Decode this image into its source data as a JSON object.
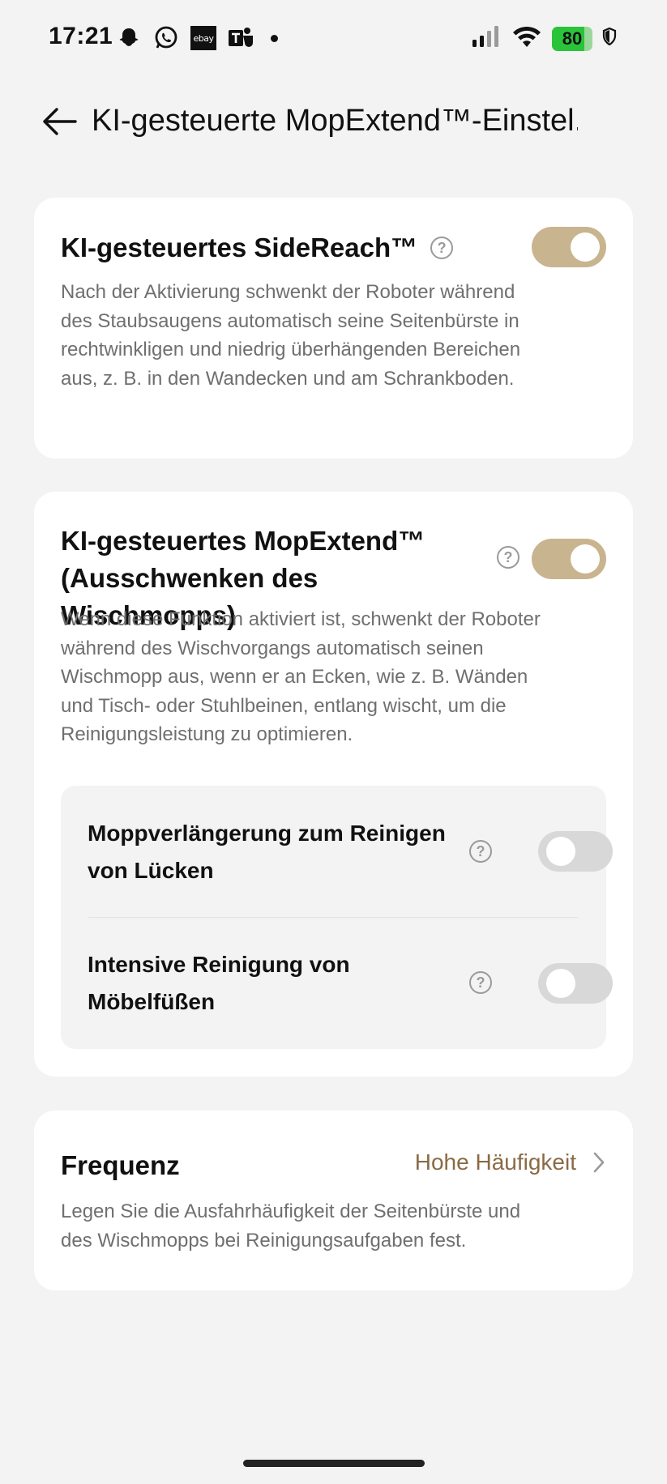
{
  "status_bar": {
    "time": "17:21",
    "notification_icons": [
      "snapchat-icon",
      "whatsapp-icon",
      "ebay-icon",
      "teams-icon"
    ],
    "ebay_label": "ebay",
    "battery_level": "80",
    "battery_color": "#29c43a"
  },
  "header": {
    "title": "KI-gesteuerte MopExtend™-Einstel..."
  },
  "sidereach": {
    "title": "KI-gesteuertes SideReach™",
    "description": "Nach der Aktivierung schwenkt der Roboter während des Staubsaugens automatisch seine Seitenbürste in rechtwinkligen und niedrig überhängenden Bereichen aus, z. B. in den Wandecken und am Schrankboden.",
    "enabled": true
  },
  "mopextend": {
    "title_line1": "KI-gesteuertes MopExtend™",
    "title_line2": "(Ausschwenken des Wischmopps)",
    "description": "Wenn diese Funktion aktiviert ist, schwenkt der Roboter während des Wischvorgangs automatisch seinen Wischmopp aus, wenn er an Ecken, wie z. B. Wänden und Tisch- oder Stuhlbeinen, entlang wischt, um die Reinigungsleistung zu optimieren.",
    "enabled": true,
    "options": [
      {
        "label_line1": "Moppverlängerung zum Reinigen",
        "label_line2": "von Lücken",
        "enabled": false
      },
      {
        "label_line1": "Intensive Reinigung von",
        "label_line2": "Möbelfüßen",
        "enabled": false
      }
    ]
  },
  "frequency": {
    "title": "Frequenz",
    "value": "Hohe Häufigkeit",
    "description": "Legen Sie die Ausfahrhäufigkeit der Seitenbürste und des Wischmopps bei Reinigungsaufgaben fest."
  },
  "colors": {
    "accent_toggle": "#c8b48e",
    "value_text": "#8a6a45",
    "background": "#f3f3f3"
  },
  "help_glyph": "?"
}
